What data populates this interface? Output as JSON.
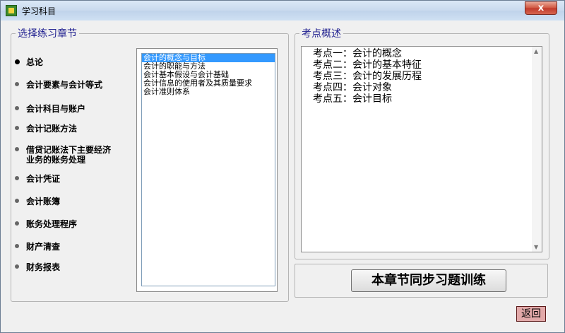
{
  "window": {
    "title": "学习科目",
    "close_label": "x"
  },
  "left_group": {
    "legend": "选择练习章节",
    "radios": [
      {
        "label": "总论",
        "checked": true
      },
      {
        "label": "会计要素与会计等式",
        "checked": false
      },
      {
        "label": "会计科目与账户",
        "checked": false
      },
      {
        "label": "会计记账方法",
        "checked": false
      },
      {
        "label": "借贷记账法下主要经济业务的账务处理",
        "checked": false
      },
      {
        "label": "会计凭证",
        "checked": false
      },
      {
        "label": "会计账簿",
        "checked": false
      },
      {
        "label": "账务处理程序",
        "checked": false
      },
      {
        "label": "财产清查",
        "checked": false
      },
      {
        "label": "财务报表",
        "checked": false
      }
    ],
    "list_items": [
      {
        "label": "会计的概念与目标",
        "selected": true
      },
      {
        "label": "会计的职能与方法",
        "selected": false
      },
      {
        "label": "会计基本假设与会计基础",
        "selected": false
      },
      {
        "label": "会计信息的使用者及其质量要求",
        "selected": false
      },
      {
        "label": "会计准则体系",
        "selected": false
      }
    ]
  },
  "right_group": {
    "legend": "考点概述",
    "lines": [
      "考点一：会计的概念",
      "考点二：会计的基本特征",
      "考点三：会计的发展历程",
      "考点四：会计对象",
      "考点五：会计目标"
    ]
  },
  "buttons": {
    "practice_label": "本章节同步习题训练",
    "return_label": "返回"
  },
  "colors": {
    "legend": "#1f1f8f",
    "selection": "#3399ff",
    "return_button": "#e2a9a9"
  }
}
